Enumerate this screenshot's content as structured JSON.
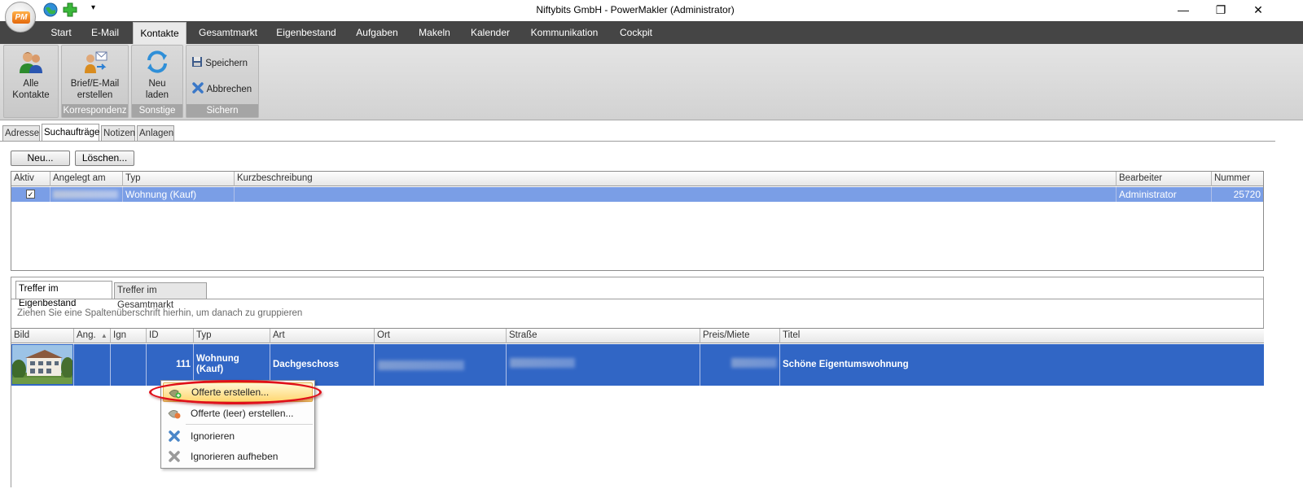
{
  "window": {
    "title": "Niftybits GmbH  - PowerMakler (Administrator)",
    "logo_text": "PM",
    "qat_dropdown": "▾",
    "controls": {
      "minimize": "—",
      "restore": "❐",
      "close": "✕"
    }
  },
  "ribbon": {
    "tabs": [
      "Start",
      "E-Mail",
      "Kontakte",
      "Gesamtmarkt",
      "Eigenbestand",
      "Aufgaben",
      "Makeln",
      "Kalender",
      "Kommunikation",
      "Cockpit"
    ],
    "active_tab": "Kontakte",
    "groups": {
      "contacts": {
        "btn_line1": "Alle",
        "btn_line2": "Kontakte"
      },
      "correspondence": {
        "btn_line1": "Brief/E-Mail",
        "btn_line2": "erstellen",
        "label": "Korrespondenz"
      },
      "other": {
        "btn_line1": "Neu",
        "btn_line2": "laden",
        "label": "Sonstige"
      },
      "save": {
        "save": "Speichern",
        "cancel": "Abbrechen",
        "label": "Sichern"
      }
    }
  },
  "page_tabs": [
    "Adresse",
    "Suchaufträge",
    "Notizen",
    "Anlagen"
  ],
  "active_page_tab": "Suchaufträge",
  "buttons": {
    "new": "Neu...",
    "delete": "Löschen..."
  },
  "search_grid": {
    "columns": [
      "Aktiv",
      "Angelegt am",
      "Typ",
      "Kurzbeschreibung",
      "Bearbeiter",
      "Nummer"
    ],
    "rows": [
      {
        "active": "✓",
        "created": "",
        "type": "Wohnung (Kauf)",
        "description": "",
        "editor": "Administrator",
        "number": "25720"
      }
    ]
  },
  "hits_tabs": [
    "Treffer im Eigenbestand",
    "Treffer im Gesamtmarkt"
  ],
  "group_hint": "Ziehen Sie eine Spaltenüberschrift hierhin, um danach zu gruppieren",
  "hits_grid": {
    "columns": [
      "Bild",
      "Ang.",
      "Ign",
      "ID",
      "Typ",
      "Art",
      "Ort",
      "Straße",
      "Preis/Miete",
      "Titel"
    ],
    "sort_indicator": "▲",
    "rows": [
      {
        "id": "111",
        "type": "Wohnung (Kauf)",
        "art": "Dachgeschoss",
        "title": "Schöne Eigentumswohnung"
      }
    ]
  },
  "context_menu": {
    "items": [
      "Offerte erstellen...",
      "Offerte (leer) erstellen...",
      "Ignorieren",
      "Ignorieren aufheben"
    ],
    "highlighted": "Offerte erstellen..."
  },
  "colors": {
    "ribbon_tabs_bg": "#454545",
    "selection_blue": "#3166c5",
    "selection_light": "#7a9ee6",
    "highlight_ring": "#e0101a"
  }
}
